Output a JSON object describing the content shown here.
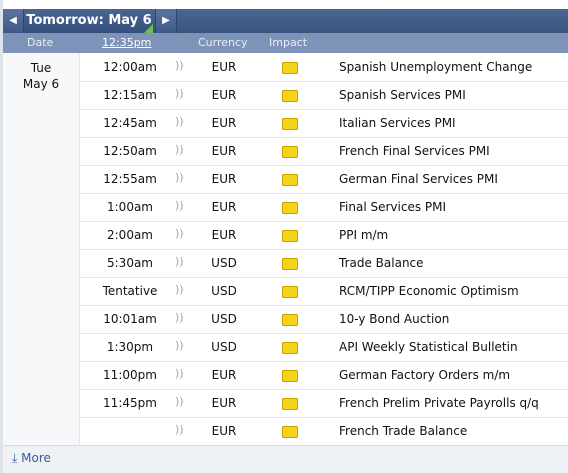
{
  "nav": {
    "prev_icon": "◀",
    "next_icon": "▶",
    "day_label": "Tomorrow: May 6"
  },
  "header": {
    "date": "Date",
    "time": "12:35pm",
    "currency": "Currency",
    "impact": "Impact"
  },
  "date_cell": {
    "weekday": "Tue",
    "day": "May 6"
  },
  "impact_color": "#f2d21a",
  "sound_icon": "🔊",
  "rows": [
    {
      "time": "12:00am",
      "currency": "EUR",
      "event": "Spanish Unemployment Change"
    },
    {
      "time": "12:15am",
      "currency": "EUR",
      "event": "Spanish Services PMI"
    },
    {
      "time": "12:45am",
      "currency": "EUR",
      "event": "Italian Services PMI"
    },
    {
      "time": "12:50am",
      "currency": "EUR",
      "event": "French Final Services PMI"
    },
    {
      "time": "12:55am",
      "currency": "EUR",
      "event": "German Final Services PMI"
    },
    {
      "time": "1:00am",
      "currency": "EUR",
      "event": "Final Services PMI"
    },
    {
      "time": "2:00am",
      "currency": "EUR",
      "event": "PPI m/m"
    },
    {
      "time": "5:30am",
      "currency": "USD",
      "event": "Trade Balance"
    },
    {
      "time": "Tentative",
      "currency": "USD",
      "event": "RCM/TIPP Economic Optimism"
    },
    {
      "time": "10:01am",
      "currency": "USD",
      "event": "10-y Bond Auction"
    },
    {
      "time": "1:30pm",
      "currency": "USD",
      "event": "API Weekly Statistical Bulletin"
    },
    {
      "time": "11:00pm",
      "currency": "EUR",
      "event": "German Factory Orders m/m"
    },
    {
      "time": "11:45pm",
      "currency": "EUR",
      "event": "French Prelim Private Payrolls q/q"
    },
    {
      "time": "",
      "currency": "EUR",
      "event": "French Trade Balance"
    }
  ],
  "footer": {
    "more_label": "More"
  }
}
